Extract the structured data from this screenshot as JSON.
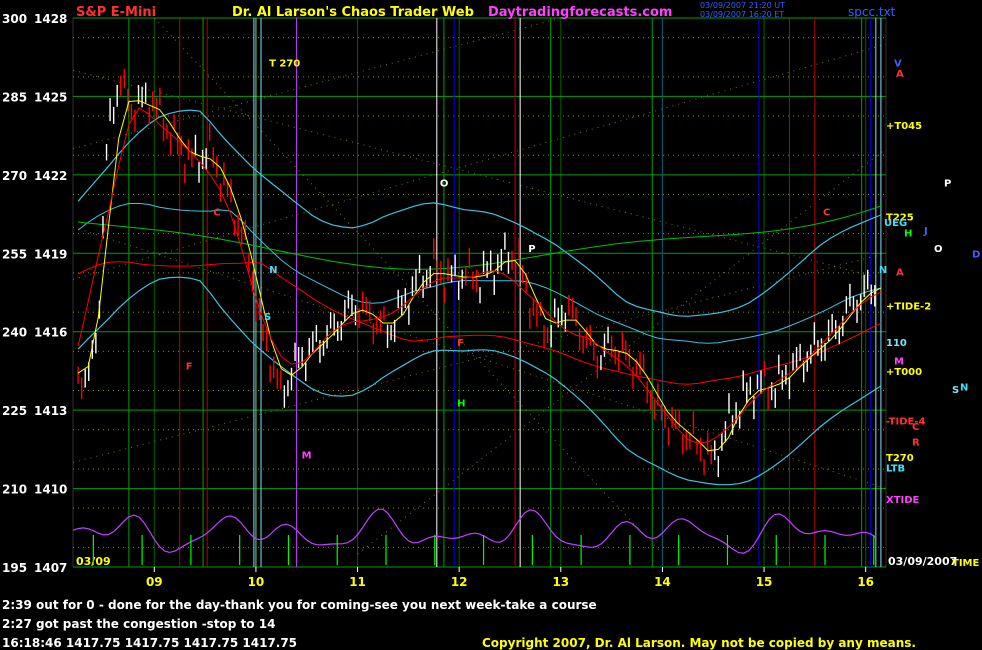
{
  "header": {
    "instrument": "S&P E-Mini",
    "title": "Dr. Al Larson's Chaos Trader Web",
    "site": "Daytradingforecasts.com",
    "file": "spcc.txt",
    "timestamp_line1": "03/09/2007 21:20 UT",
    "timestamp_line2": "03/09/2007 16:20 ET"
  },
  "footer": {
    "note1": "2:39 out for 0 - done for the day-thank you for coming-see you next week-take a course",
    "note2": "2:27 got past the congestion -stop to 14",
    "quote": "16:18:46  1417.75 1417.75 1417.75 1417.75",
    "copyright": "Copyright 2007, Dr. Al Larson. May not be copied by any means."
  },
  "colors": {
    "background": "#000000",
    "grid_dotted": "#c8c800",
    "price_bars": "#ffffff",
    "down_bars": "#ff0000",
    "moving_avg_1": "#ffff00",
    "moving_avg_2": "#ff0000",
    "band_lines": "#40c0e0",
    "green_line": "#00c000",
    "xtide_line": "#c040ff",
    "vertical_green": "#00a000",
    "vertical_blue": "#0000ff",
    "vertical_red": "#c00000",
    "vertical_cyan": "#80e0ff"
  },
  "chart_data": {
    "type": "candlestick",
    "date_start_label": "03/09",
    "date_end_label": "03/09/2007",
    "x_unit": "hour (ET)",
    "xlim": [
      8.2,
      16.2
    ],
    "ylim": [
      1407,
      1428
    ],
    "y_ticks": [
      {
        "left": "300",
        "price": "1428",
        "value": 1428
      },
      {
        "left": "285",
        "price": "1425",
        "value": 1425
      },
      {
        "left": "270",
        "price": "1422",
        "value": 1422
      },
      {
        "left": "255",
        "price": "1419",
        "value": 1419
      },
      {
        "left": "240",
        "price": "1416",
        "value": 1416
      },
      {
        "left": "225",
        "price": "1413",
        "value": 1413
      },
      {
        "left": "210",
        "price": "1410",
        "value": 1410
      },
      {
        "left": "195",
        "price": "1407",
        "value": 1407
      }
    ],
    "x_ticks": [
      {
        "label": "09",
        "value": 9
      },
      {
        "label": "10",
        "value": 10
      },
      {
        "label": "11",
        "value": 11
      },
      {
        "label": "12",
        "value": 12
      },
      {
        "label": "13",
        "value": 13
      },
      {
        "label": "14",
        "value": 14
      },
      {
        "label": "15",
        "value": 15
      },
      {
        "label": "16",
        "value": 16
      }
    ],
    "grid": true,
    "price_path": [
      [
        8.25,
        1414.5
      ],
      [
        8.35,
        1414.0
      ],
      [
        8.45,
        1416.5
      ],
      [
        8.55,
        1424.0
      ],
      [
        8.65,
        1425.5
      ],
      [
        8.8,
        1424.5
      ],
      [
        8.95,
        1425.0
      ],
      [
        9.1,
        1424.0
      ],
      [
        9.25,
        1423.0
      ],
      [
        9.4,
        1422.5
      ],
      [
        9.55,
        1423.0
      ],
      [
        9.65,
        1422.0
      ],
      [
        9.8,
        1420.5
      ],
      [
        9.95,
        1418.5
      ],
      [
        10.05,
        1416.0
      ],
      [
        10.15,
        1415.0
      ],
      [
        10.25,
        1413.5
      ],
      [
        10.35,
        1414.5
      ],
      [
        10.45,
        1415.0
      ],
      [
        10.6,
        1415.5
      ],
      [
        10.75,
        1416.0
      ],
      [
        10.9,
        1416.8
      ],
      [
        11.0,
        1417.0
      ],
      [
        11.15,
        1416.5
      ],
      [
        11.3,
        1416.0
      ],
      [
        11.45,
        1417.0
      ],
      [
        11.6,
        1418.0
      ],
      [
        11.75,
        1418.5
      ],
      [
        11.9,
        1418.0
      ],
      [
        12.05,
        1418.2
      ],
      [
        12.2,
        1418.0
      ],
      [
        12.35,
        1418.5
      ],
      [
        12.5,
        1419.0
      ],
      [
        12.6,
        1418.5
      ],
      [
        12.75,
        1416.5
      ],
      [
        12.9,
        1416.0
      ],
      [
        13.05,
        1417.0
      ],
      [
        13.2,
        1416.0
      ],
      [
        13.35,
        1415.0
      ],
      [
        13.5,
        1415.5
      ],
      [
        13.65,
        1415.0
      ],
      [
        13.8,
        1414.5
      ],
      [
        13.95,
        1413.0
      ],
      [
        14.1,
        1412.5
      ],
      [
        14.25,
        1412.0
      ],
      [
        14.4,
        1411.5
      ],
      [
        14.5,
        1411.0
      ],
      [
        14.65,
        1412.5
      ],
      [
        14.8,
        1413.5
      ],
      [
        14.95,
        1414.0
      ],
      [
        15.1,
        1413.8
      ],
      [
        15.25,
        1414.5
      ],
      [
        15.4,
        1415.0
      ],
      [
        15.55,
        1415.5
      ],
      [
        15.7,
        1416.0
      ],
      [
        15.85,
        1417.0
      ],
      [
        16.0,
        1417.5
      ],
      [
        16.1,
        1417.75
      ]
    ],
    "reference_lines": [
      {
        "label": "T 270",
        "x": 10.1,
        "y": 1426.3
      },
      {
        "label": "O",
        "x": 11.78,
        "y": 1421.7
      },
      {
        "label": "P",
        "x": 12.65,
        "y": 1419.2
      },
      {
        "label": "N",
        "x": 10.1,
        "y": 1418.4
      },
      {
        "label": "S",
        "x": 10.05,
        "y": 1416.6
      },
      {
        "label": "M",
        "x": 10.42,
        "y": 1411.3
      },
      {
        "label": "F",
        "x": 9.28,
        "y": 1414.7
      },
      {
        "label": "C",
        "x": 9.55,
        "y": 1420.6
      },
      {
        "label": "H",
        "x": 11.95,
        "y": 1413.3
      },
      {
        "label": "F",
        "x": 11.95,
        "y": 1415.6
      },
      {
        "label": "C",
        "x": 15.55,
        "y": 1420.6
      },
      {
        "label": "N",
        "x": 16.1,
        "y": 1418.4
      }
    ],
    "right_labels": [
      {
        "label": "V",
        "value": 1426.3,
        "color": "#4060ff"
      },
      {
        "label": "A",
        "value": 1425.9,
        "color": "#ff3030"
      },
      {
        "label": "+T045",
        "value": 1423.9,
        "color": "#ffff00"
      },
      {
        "label": "P",
        "value": 1421.7,
        "color": "#ffffff"
      },
      {
        "label": "T225",
        "value": 1420.4,
        "color": "#ffff00"
      },
      {
        "label": "UEG",
        "value": 1420.2,
        "color": "#40e0ff"
      },
      {
        "label": "H",
        "value": 1419.8,
        "color": "#00ff00"
      },
      {
        "label": "J",
        "value": 1419.9,
        "color": "#4060ff"
      },
      {
        "label": "O",
        "value": 1419.2,
        "color": "#ffffff"
      },
      {
        "label": "D",
        "value": 1419.0,
        "color": "#4060ff"
      },
      {
        "label": "A",
        "value": 1418.3,
        "color": "#ff3030"
      },
      {
        "label": "+TIDE-2",
        "value": 1417.0,
        "color": "#ffff00"
      },
      {
        "label": "110",
        "value": 1415.6,
        "color": "#80e0ff"
      },
      {
        "label": "M",
        "value": 1414.9,
        "color": "#ff40ff"
      },
      {
        "label": "+T000",
        "value": 1414.5,
        "color": "#ffff00"
      },
      {
        "label": "S",
        "value": 1413.8,
        "color": "#80e0ff"
      },
      {
        "label": "N",
        "value": 1413.9,
        "color": "#40e0ff"
      },
      {
        "label": "-TIDE-4",
        "value": 1412.6,
        "color": "#ff3030"
      },
      {
        "label": "C",
        "value": 1412.4,
        "color": "#ff3030"
      },
      {
        "label": "R",
        "value": 1411.8,
        "color": "#ff3030"
      },
      {
        "label": "T270",
        "value": 1411.2,
        "color": "#ffff00"
      },
      {
        "label": "LTB",
        "value": 1410.8,
        "color": "#40e0ff"
      },
      {
        "label": "XTIDE",
        "value": 1409.6,
        "color": "#ff40ff"
      },
      {
        "label": "TIME",
        "value": 1407.2,
        "color": "#ffff00"
      }
    ],
    "vertical_markers": [
      {
        "x": 8.75,
        "color": "#00a000"
      },
      {
        "x": 9.25,
        "color": "#c00000"
      },
      {
        "x": 9.48,
        "color": "#00a000"
      },
      {
        "x": 9.52,
        "color": "#c00000"
      },
      {
        "x": 9.98,
        "color": "#80e0ff"
      },
      {
        "x": 10.05,
        "color": "#80e0ff"
      },
      {
        "x": 10.4,
        "color": "#c040ff"
      },
      {
        "x": 10.0,
        "color": "#ffffff"
      },
      {
        "x": 11.78,
        "color": "#ffffff"
      },
      {
        "x": 11.85,
        "color": "#00a000"
      },
      {
        "x": 11.95,
        "color": "#0000ff"
      },
      {
        "x": 12.55,
        "color": "#c00000"
      },
      {
        "x": 12.6,
        "color": "#ffffff"
      },
      {
        "x": 12.9,
        "color": "#00a000"
      },
      {
        "x": 13.9,
        "color": "#00a000"
      },
      {
        "x": 14.0,
        "color": "#0000ff"
      },
      {
        "x": 14.95,
        "color": "#0000ff"
      },
      {
        "x": 15.25,
        "color": "#c00000"
      },
      {
        "x": 15.5,
        "color": "#c00000"
      },
      {
        "x": 15.96,
        "color": "#00a000"
      },
      {
        "x": 16.05,
        "color": "#0000ff"
      },
      {
        "x": 16.1,
        "color": "#80e0ff"
      },
      {
        "x": 16.15,
        "color": "#80e0ff"
      }
    ]
  }
}
